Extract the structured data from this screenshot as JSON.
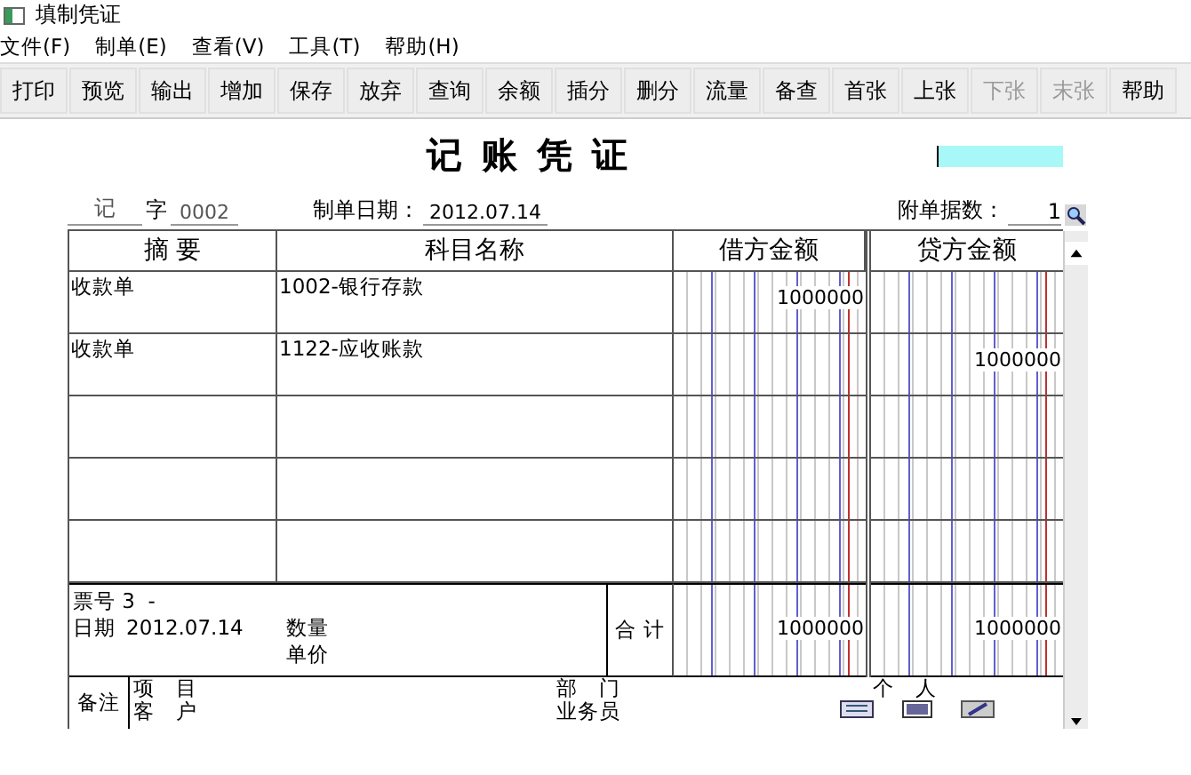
{
  "window": {
    "title": "填制凭证"
  },
  "menu": [
    {
      "label": "文件(F)"
    },
    {
      "label": "制单(E)"
    },
    {
      "label": "查看(V)"
    },
    {
      "label": "工具(T)"
    },
    {
      "label": "帮助(H)"
    }
  ],
  "toolbar": [
    {
      "label": "打印",
      "disabled": false
    },
    {
      "label": "预览",
      "disabled": false
    },
    {
      "label": "输出",
      "disabled": false
    },
    {
      "label": "增加",
      "disabled": false
    },
    {
      "label": "保存",
      "disabled": false
    },
    {
      "label": "放弃",
      "disabled": false
    },
    {
      "label": "查询",
      "disabled": false
    },
    {
      "label": "余额",
      "disabled": false
    },
    {
      "label": "插分",
      "disabled": false
    },
    {
      "label": "删分",
      "disabled": false
    },
    {
      "label": "流量",
      "disabled": false
    },
    {
      "label": "备查",
      "disabled": false
    },
    {
      "label": "首张",
      "disabled": false
    },
    {
      "label": "上张",
      "disabled": false
    },
    {
      "label": "下张",
      "disabled": true
    },
    {
      "label": "末张",
      "disabled": true
    },
    {
      "label": "帮助",
      "disabled": false
    }
  ],
  "voucher": {
    "title": "记 账 凭 证",
    "type": "记",
    "word_label": "字",
    "number": "0002",
    "date_label": "制单日期：",
    "date": "2012.07.14",
    "attachments_label": "附单据数：",
    "attachments": "1",
    "headers": [
      "摘 要",
      "科目名称",
      "借方金额",
      "贷方金额"
    ],
    "rows": [
      {
        "summary": "收款单",
        "account": "1002-银行存款",
        "debit": "1000000"
      },
      {
        "summary": "收款单",
        "account": "1122-应收账款",
        "credit": "1000000"
      }
    ],
    "footer": {
      "ticket_label": "票号",
      "ticket": "3  -",
      "date_label": "日期",
      "date": "2012.07.14",
      "quantity_label": "数量",
      "price_label": "单价",
      "total_label": "合 计",
      "debit_total": "1000000",
      "credit_total": "1000000"
    },
    "remarks": {
      "label": "备注",
      "project_label": "项　目",
      "customer_label": "客　户",
      "department_label": "部　门",
      "salesperson_label": "业务员",
      "person_label": "个　人"
    }
  }
}
